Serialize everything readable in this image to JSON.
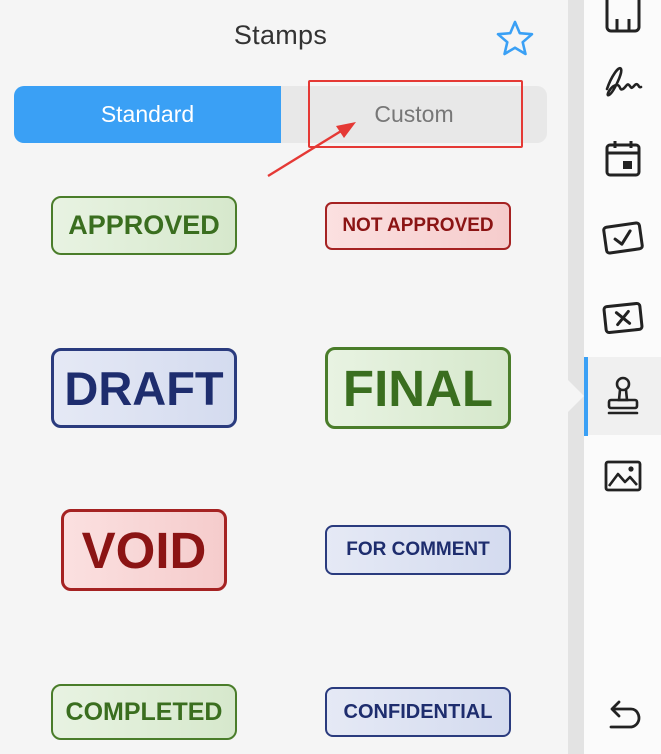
{
  "panel": {
    "title": "Stamps"
  },
  "tabs": {
    "standard_label": "Standard",
    "custom_label": "Custom",
    "selected": "Standard"
  },
  "stamps": [
    {
      "label": "APPROVED",
      "color": "green"
    },
    {
      "label": "NOT APPROVED",
      "color": "red"
    },
    {
      "label": "DRAFT",
      "color": "blue"
    },
    {
      "label": "FINAL",
      "color": "green"
    },
    {
      "label": "VOID",
      "color": "red"
    },
    {
      "label": "FOR COMMENT",
      "color": "blue"
    },
    {
      "label": "COMPLETED",
      "color": "green"
    },
    {
      "label": "CONFIDENTIAL",
      "color": "blue"
    }
  ],
  "toolbar": {
    "items": [
      {
        "icon": "text-box-icon"
      },
      {
        "icon": "signature-icon"
      },
      {
        "icon": "calendar-icon"
      },
      {
        "icon": "checkmark-box-icon"
      },
      {
        "icon": "cross-box-icon"
      },
      {
        "icon": "stamp-icon",
        "active": true
      },
      {
        "icon": "image-icon"
      },
      {
        "icon": "undo-icon"
      }
    ]
  },
  "colors": {
    "accent": "#3aa0f5",
    "annotation": "#e53935",
    "stamp_green": "#3a6e1f",
    "stamp_red": "#8b1414",
    "stamp_blue": "#1e2d6e"
  }
}
